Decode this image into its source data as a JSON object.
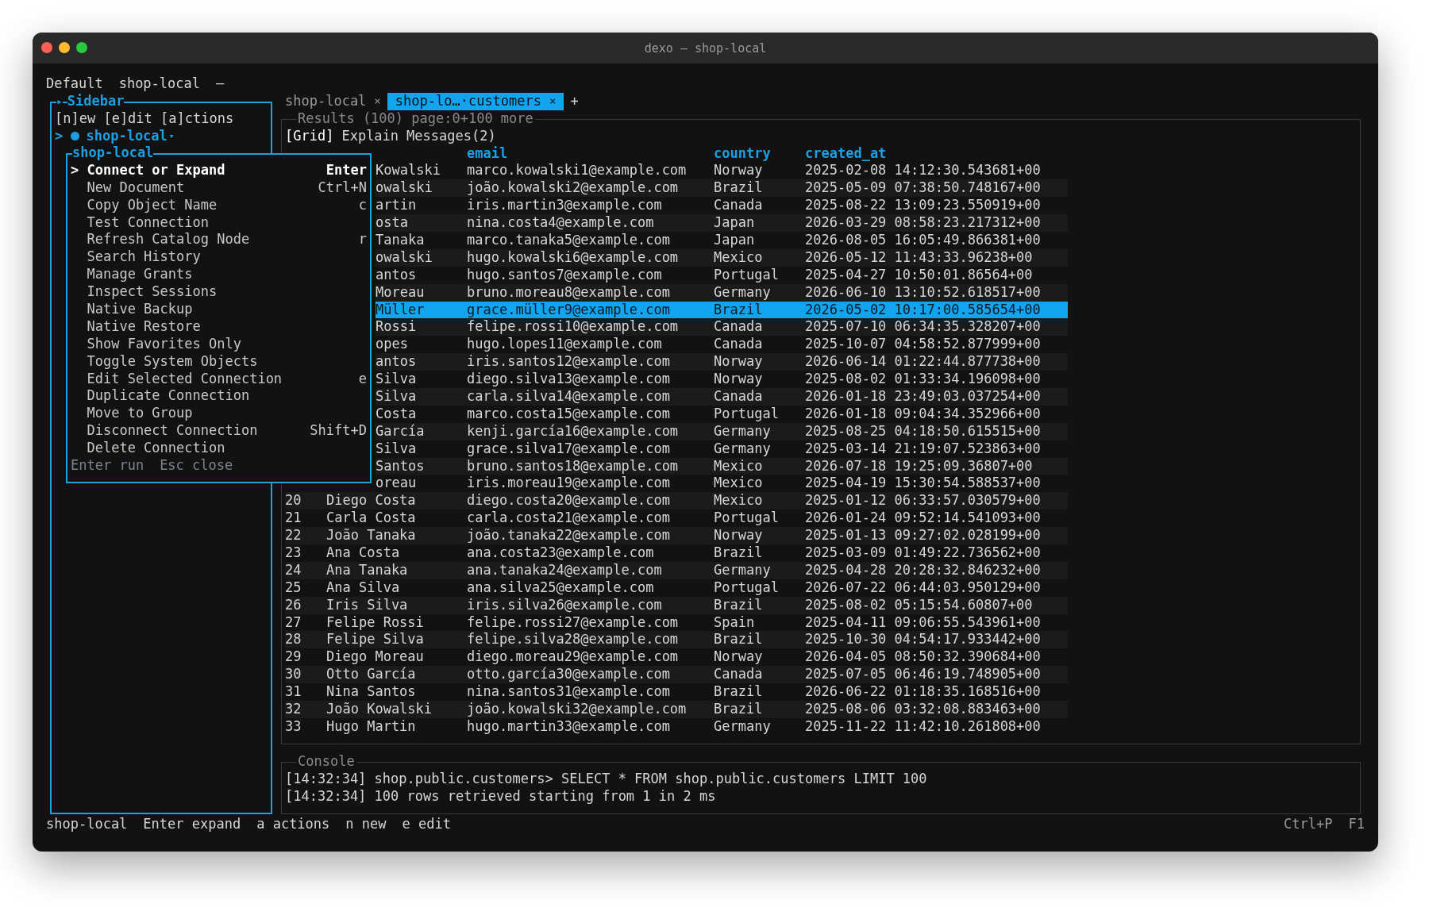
{
  "window": {
    "title": "dexo — shop-local"
  },
  "top_bar": [
    "Default",
    "shop-local",
    "—"
  ],
  "sidebar": {
    "marker": "▸",
    "title": "Sidebar",
    "help": "[n]ew [e]dit [a]ctions",
    "cursor": ">",
    "connections": [
      {
        "name": "shop-local",
        "caret": "▾",
        "selected": true,
        "connected": true
      }
    ]
  },
  "tabs": [
    {
      "label": "shop-local",
      "close": "×",
      "selected": false
    },
    {
      "label": "shop-lo…·customers",
      "close": "×",
      "selected": true
    }
  ],
  "new_tab": "+",
  "results": {
    "title": "Results (100) page:0+100 more",
    "views": [
      {
        "label": "[Grid]",
        "selected": true
      },
      {
        "label": "Explain",
        "selected": false
      },
      {
        "label": "Messages(2)",
        "selected": false
      }
    ],
    "columns": [
      "email",
      "country",
      "created_at"
    ],
    "rows": [
      {
        "name": "Kowalski",
        "email": "marco.kowalski1@example.com",
        "country": "Norway",
        "created_at": "2025-02-08 14:12:30.543681+00",
        "selected": false
      },
      {
        "name": "owalski",
        "email": "joão.kowalski2@example.com",
        "country": "Brazil",
        "created_at": "2025-05-09 07:38:50.748167+00",
        "selected": false
      },
      {
        "name": "artin",
        "email": "iris.martin3@example.com",
        "country": "Canada",
        "created_at": "2025-08-22 13:09:23.550919+00",
        "selected": false
      },
      {
        "name": "osta",
        "email": "nina.costa4@example.com",
        "country": "Japan",
        "created_at": "2026-03-29 08:58:23.217312+00",
        "selected": false
      },
      {
        "name": "Tanaka",
        "email": "marco.tanaka5@example.com",
        "country": "Japan",
        "created_at": "2026-08-05 16:05:49.866381+00",
        "selected": false
      },
      {
        "name": "owalski",
        "email": "hugo.kowalski6@example.com",
        "country": "Mexico",
        "created_at": "2026-05-12 11:43:33.96238+00",
        "selected": false
      },
      {
        "name": "antos",
        "email": "hugo.santos7@example.com",
        "country": "Portugal",
        "created_at": "2025-04-27 10:50:01.86564+00",
        "selected": false
      },
      {
        "name": "Moreau",
        "email": "bruno.moreau8@example.com",
        "country": "Germany",
        "created_at": "2026-06-10 13:10:52.618517+00",
        "selected": false
      },
      {
        "name": "Müller",
        "email": "grace.müller9@example.com",
        "country": "Brazil",
        "created_at": "2026-05-02 10:17:00.585654+00",
        "selected": true
      },
      {
        "name": "Rossi",
        "email": "felipe.rossi10@example.com",
        "country": "Canada",
        "created_at": "2025-07-10 06:34:35.328207+00",
        "selected": false
      },
      {
        "name": "opes",
        "email": "hugo.lopes11@example.com",
        "country": "Canada",
        "created_at": "2025-10-07 04:58:52.877999+00",
        "selected": false
      },
      {
        "name": "antos",
        "email": "iris.santos12@example.com",
        "country": "Norway",
        "created_at": "2026-06-14 01:22:44.877738+00",
        "selected": false
      },
      {
        "name": "Silva",
        "email": "diego.silva13@example.com",
        "country": "Norway",
        "created_at": "2025-08-02 01:33:34.196098+00",
        "selected": false
      },
      {
        "name": "Silva",
        "email": "carla.silva14@example.com",
        "country": "Canada",
        "created_at": "2026-01-18 23:49:03.037254+00",
        "selected": false
      },
      {
        "name": "Costa",
        "email": "marco.costa15@example.com",
        "country": "Portugal",
        "created_at": "2026-01-18 09:04:34.352966+00",
        "selected": false
      },
      {
        "name": "García",
        "email": "kenji.garcía16@example.com",
        "country": "Germany",
        "created_at": "2025-08-25 04:18:50.615515+00",
        "selected": false
      },
      {
        "name": "Silva",
        "email": "grace.silva17@example.com",
        "country": "Germany",
        "created_at": "2025-03-14 21:19:07.523863+00",
        "selected": false
      },
      {
        "name": "Santos",
        "email": "bruno.santos18@example.com",
        "country": "Mexico",
        "created_at": "2026-07-18 19:25:09.36807+00",
        "selected": false
      },
      {
        "name": "oreau",
        "email": "iris.moreau19@example.com",
        "country": "Mexico",
        "created_at": "2025-04-19 15:30:54.588537+00",
        "selected": false
      },
      {
        "number": "20",
        "name": "Diego Costa",
        "email": "diego.costa20@example.com",
        "country": "Mexico",
        "created_at": "2025-01-12 06:33:57.030579+00",
        "selected": false
      },
      {
        "number": "21",
        "name": "Carla Costa",
        "email": "carla.costa21@example.com",
        "country": "Portugal",
        "created_at": "2026-01-24 09:52:14.541093+00",
        "selected": false
      },
      {
        "number": "22",
        "name": "João Tanaka",
        "email": "joão.tanaka22@example.com",
        "country": "Norway",
        "created_at": "2025-01-13 09:27:02.028199+00",
        "selected": false
      },
      {
        "number": "23",
        "name": "Ana Costa",
        "email": "ana.costa23@example.com",
        "country": "Brazil",
        "created_at": "2025-03-09 01:49:22.736562+00",
        "selected": false
      },
      {
        "number": "24",
        "name": "Ana Tanaka",
        "email": "ana.tanaka24@example.com",
        "country": "Germany",
        "created_at": "2025-04-28 20:28:32.846232+00",
        "selected": false
      },
      {
        "number": "25",
        "name": "Ana Silva",
        "email": "ana.silva25@example.com",
        "country": "Portugal",
        "created_at": "2026-07-22 06:44:03.950129+00",
        "selected": false
      },
      {
        "number": "26",
        "name": "Iris Silva",
        "email": "iris.silva26@example.com",
        "country": "Brazil",
        "created_at": "2025-08-02 05:15:54.60807+00",
        "selected": false
      },
      {
        "number": "27",
        "name": "Felipe Rossi",
        "email": "felipe.rossi27@example.com",
        "country": "Spain",
        "created_at": "2025-04-11 09:06:55.543961+00",
        "selected": false
      },
      {
        "number": "28",
        "name": "Felipe Silva",
        "email": "felipe.silva28@example.com",
        "country": "Brazil",
        "created_at": "2025-10-30 04:54:17.933442+00",
        "selected": false
      },
      {
        "number": "29",
        "name": "Diego Moreau",
        "email": "diego.moreau29@example.com",
        "country": "Norway",
        "created_at": "2026-04-05 08:50:32.390684+00",
        "selected": false
      },
      {
        "number": "30",
        "name": "Otto García",
        "email": "otto.garcía30@example.com",
        "country": "Canada",
        "created_at": "2025-07-05 06:46:19.748905+00",
        "selected": false
      },
      {
        "number": "31",
        "name": "Nina Santos",
        "email": "nina.santos31@example.com",
        "country": "Brazil",
        "created_at": "2026-06-22 01:18:35.168516+00",
        "selected": false
      },
      {
        "number": "32",
        "name": "João Kowalski",
        "email": "joão.kowalski32@example.com",
        "country": "Brazil",
        "created_at": "2025-08-06 03:32:08.883463+00",
        "selected": false
      },
      {
        "number": "33",
        "name": "Hugo Martin",
        "email": "hugo.martin33@example.com",
        "country": "Germany",
        "created_at": "2025-11-22 11:42:10.261808+00",
        "selected": false
      }
    ]
  },
  "console": {
    "title": "Console",
    "lines": [
      "[14:32:34] shop.public.customers> SELECT * FROM shop.public.customers LIMIT 100",
      "[14:32:34] 100 rows retrieved starting from 1 in 2 ms"
    ]
  },
  "status_bar": {
    "left": [
      "shop-local",
      "Enter expand",
      "a actions",
      "n new",
      "e edit"
    ],
    "right": [
      "Ctrl+P",
      "F1"
    ]
  },
  "popup": {
    "title": "shop-local",
    "cursor": ">",
    "items": [
      {
        "label": "Connect or Expand",
        "shortcut": "Enter",
        "selected": true
      },
      {
        "label": "New Document",
        "shortcut": "Ctrl+N",
        "selected": false
      },
      {
        "label": "Copy Object Name",
        "shortcut": "c",
        "selected": false
      },
      {
        "label": "Test Connection",
        "selected": false
      },
      {
        "label": "Refresh Catalog Node",
        "shortcut": "r",
        "selected": false
      },
      {
        "label": "Search History",
        "selected": false
      },
      {
        "label": "Manage Grants",
        "selected": false
      },
      {
        "label": "Inspect Sessions",
        "selected": false
      },
      {
        "label": "Native Backup",
        "selected": false
      },
      {
        "label": "Native Restore",
        "selected": false
      },
      {
        "label": "Show Favorites Only",
        "selected": false
      },
      {
        "label": "Toggle System Objects",
        "selected": false
      },
      {
        "label": "Edit Selected Connection",
        "shortcut": "e",
        "selected": false
      },
      {
        "label": "Duplicate Connection",
        "selected": false
      },
      {
        "label": "Move to Group",
        "selected": false
      },
      {
        "label": "Disconnect Connection",
        "shortcut": "Shift+D",
        "selected": false
      },
      {
        "label": "Delete Connection",
        "selected": false
      }
    ],
    "hints": [
      "Enter run",
      "Esc close"
    ]
  }
}
